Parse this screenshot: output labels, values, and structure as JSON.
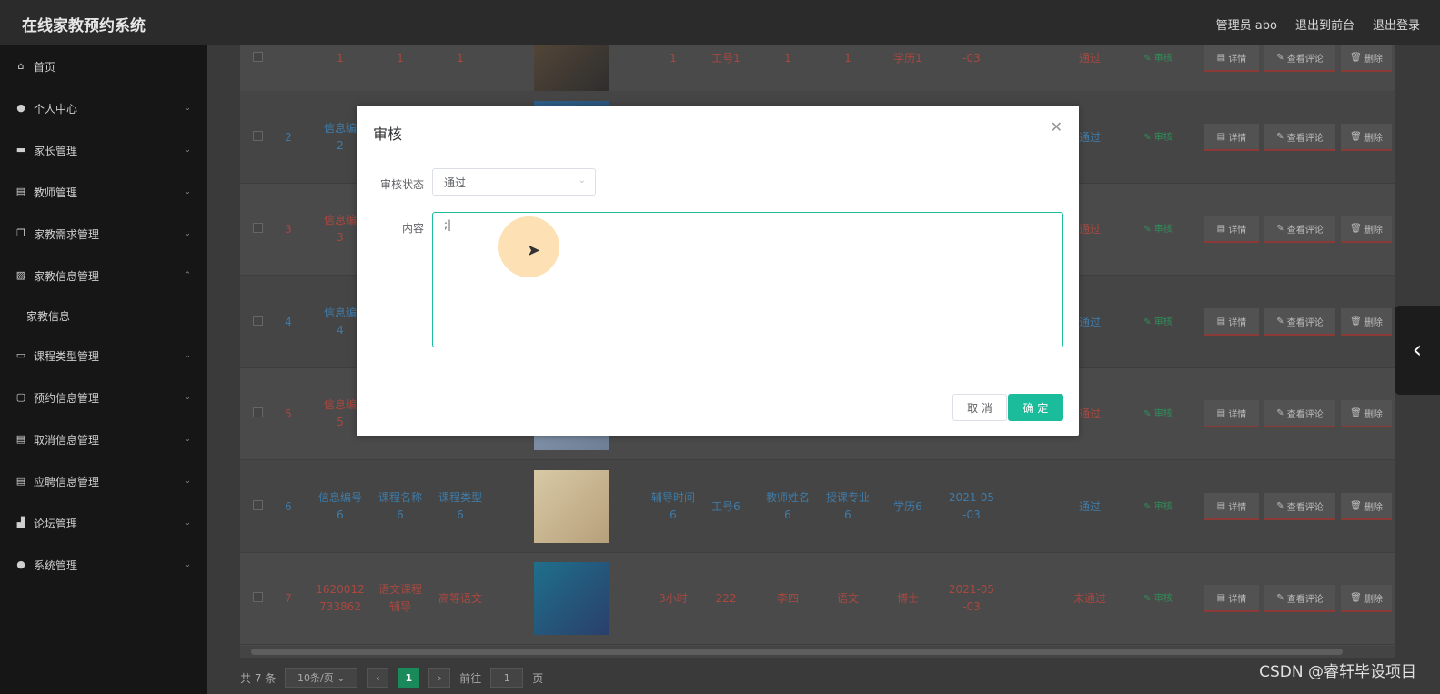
{
  "header": {
    "title": "在线家教预约系统",
    "admin": "管理员 abo",
    "to_front": "退出到前台",
    "logout": "退出登录"
  },
  "sidebar": {
    "items": [
      {
        "label": "首页",
        "icon": "home-icon"
      },
      {
        "label": "个人中心",
        "icon": "user-icon"
      },
      {
        "label": "家长管理",
        "icon": "briefcase-icon"
      },
      {
        "label": "教师管理",
        "icon": "clipboard-icon"
      },
      {
        "label": "家教需求管理",
        "icon": "copy-icon"
      },
      {
        "label": "家教信息管理",
        "icon": "chart-icon"
      },
      {
        "label": "家教信息",
        "icon": ""
      },
      {
        "label": "课程类型管理",
        "icon": "monitor-icon"
      },
      {
        "label": "预约信息管理",
        "icon": "chat-icon"
      },
      {
        "label": "取消信息管理",
        "icon": "clipboard-icon"
      },
      {
        "label": "应聘信息管理",
        "icon": "clipboard-icon"
      },
      {
        "label": "论坛管理",
        "icon": "forum-icon"
      },
      {
        "label": "系统管理",
        "icon": "user-icon"
      }
    ]
  },
  "table": {
    "rows": [
      {
        "index": "",
        "id": "1",
        "name": "1",
        "type": "1",
        "time": "1",
        "job": "工号1",
        "teacher": "1",
        "major": "1",
        "edu": "学历1",
        "date": "-03",
        "status": "通过"
      },
      {
        "index": "2",
        "id": "信息编\n2",
        "status": "通过"
      },
      {
        "index": "3",
        "id": "信息编\n3",
        "status": "通过"
      },
      {
        "index": "4",
        "id": "信息编\n4",
        "status": "通过"
      },
      {
        "index": "5",
        "id": "信息编\n5",
        "status": "通过"
      },
      {
        "index": "6",
        "id": "信息编号\n6",
        "name": "课程名称\n6",
        "type": "课程类型\n6",
        "time": "辅导时间\n6",
        "job": "工号6",
        "teacher": "教师姓名\n6",
        "major": "授课专业\n6",
        "edu": "学历6",
        "date": "2021-05\n-03",
        "status": "通过"
      },
      {
        "index": "7",
        "id": "1620012\n733862",
        "name": "语文课程\n辅导",
        "type": "高等语文",
        "time": "3小时",
        "job": "222",
        "teacher": "李四",
        "major": "语文",
        "edu": "博士",
        "date": "2021-05\n-03",
        "status": "未通过"
      }
    ],
    "review_label": "审核",
    "detail_label": "详情",
    "comment_label": "查看评论",
    "delete_label": "删除"
  },
  "pager": {
    "total": "共 7 条",
    "page_size": "10条/页",
    "current": "1",
    "goto_prefix": "前往",
    "goto_value": "1",
    "goto_suffix": "页"
  },
  "dialog": {
    "title": "审核",
    "status_label": "审核状态",
    "status_value": "通过",
    "content_label": "内容",
    "content_value": ";|",
    "cancel": "取 消",
    "ok": "确 定"
  },
  "watermark": "CSDN @睿轩毕设项目",
  "colors": {
    "accent": "#1abc9c",
    "sidebar_bg": "#161616",
    "header_bg": "#2b2b2b"
  }
}
